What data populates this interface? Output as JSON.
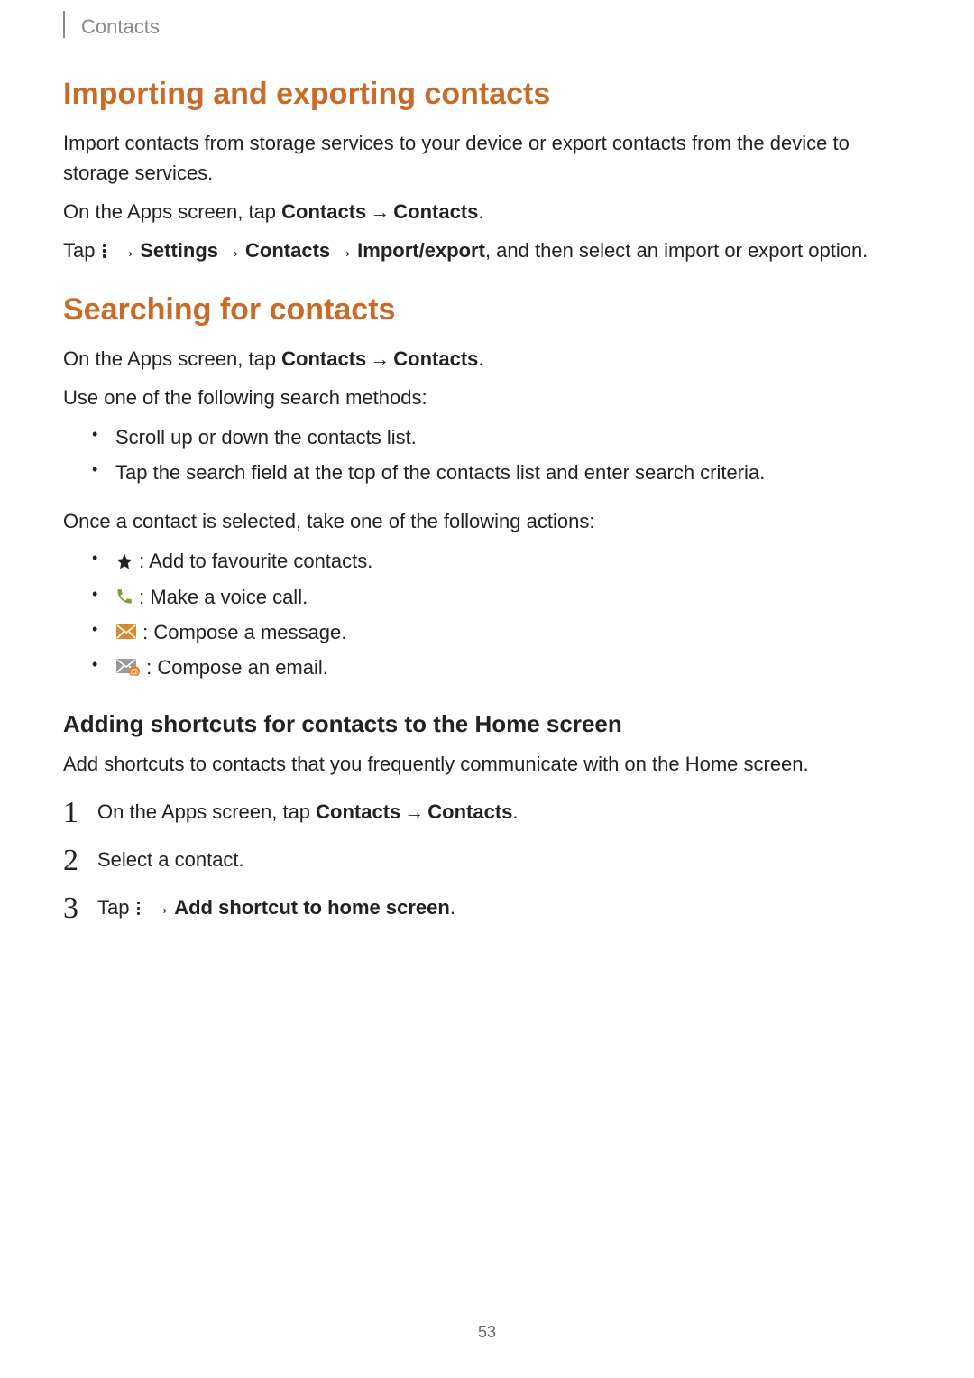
{
  "header": {
    "section": "Contacts"
  },
  "h1": "Importing and exporting contacts",
  "p1": "Import contacts from storage services to your device or export contacts from the device to storage services.",
  "p2": {
    "pre": "On the Apps screen, tap ",
    "b1": "Contacts",
    "b2": "Contacts",
    "post": "."
  },
  "p3": {
    "pre": "Tap ",
    "b1": "Settings",
    "b2": "Contacts",
    "b3": "Import/export",
    "post": ", and then select an import or export option."
  },
  "h2": "Searching for contacts",
  "p4": {
    "pre": "On the Apps screen, tap ",
    "b1": "Contacts",
    "b2": "Contacts",
    "post": "."
  },
  "p5": "Use one of the following search methods:",
  "list1": {
    "i0": "Scroll up or down the contacts list.",
    "i1": "Tap the search field at the top of the contacts list and enter search criteria."
  },
  "p6": "Once a contact is selected, take one of the following actions:",
  "list2": {
    "i0": " : Add to favourite contacts.",
    "i1": " : Make a voice call.",
    "i2": " : Compose a message.",
    "i3": " : Compose an email."
  },
  "h3": "Adding shortcuts for contacts to the Home screen",
  "p7": "Add shortcuts to contacts that you frequently communicate with on the Home screen.",
  "steps": {
    "s1": {
      "pre": "On the Apps screen, tap ",
      "b1": "Contacts",
      "b2": "Contacts",
      "post": "."
    },
    "s2": "Select a contact.",
    "s3": {
      "pre": "Tap ",
      "b1": "Add shortcut to home screen",
      "post": "."
    }
  },
  "arrow": "→",
  "pageNumber": "53"
}
